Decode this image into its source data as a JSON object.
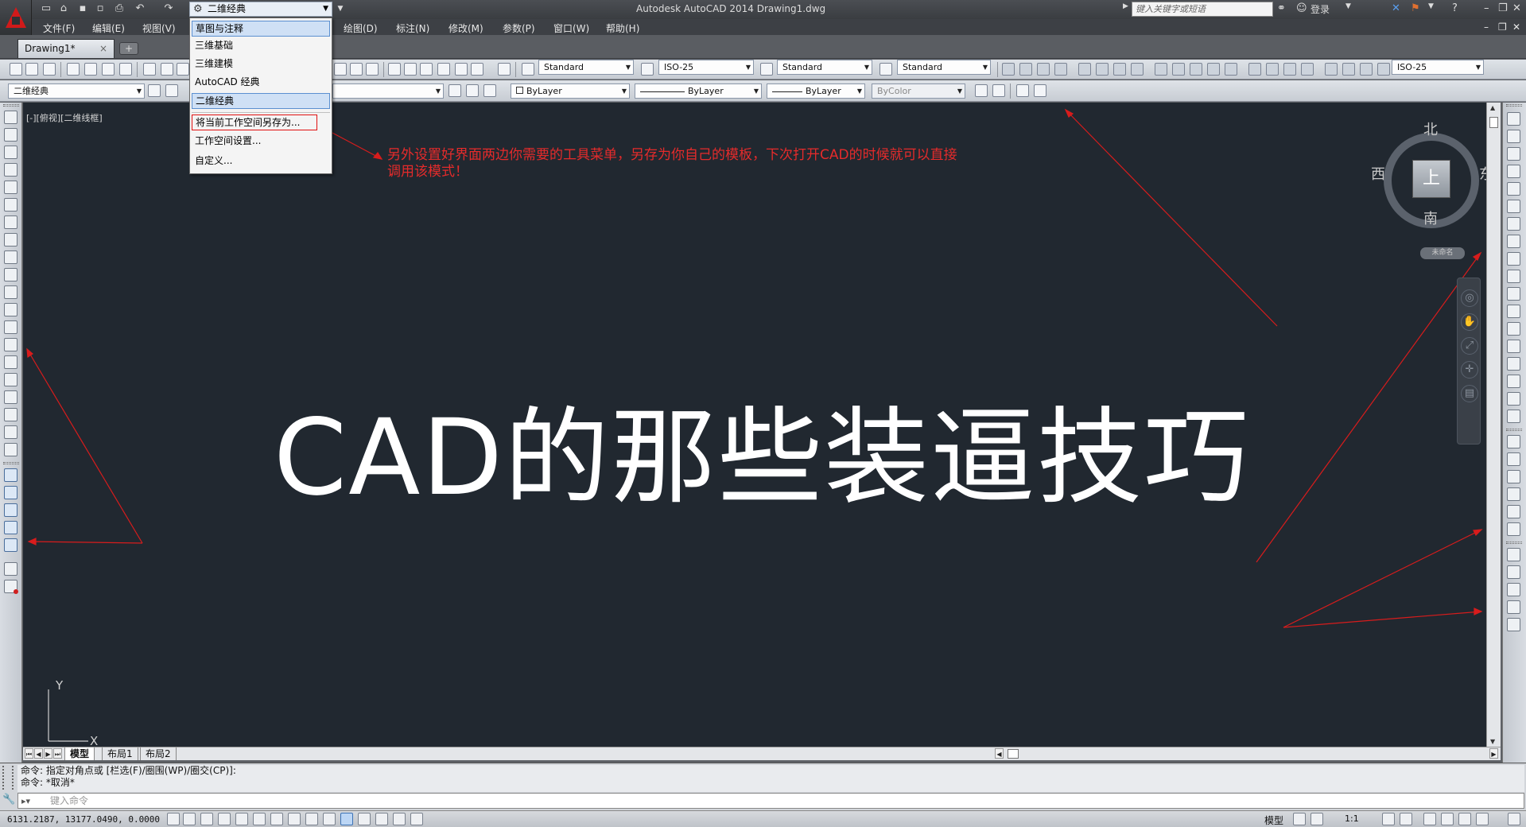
{
  "title_bar": {
    "workspace_current": "二维经典",
    "app_title": "Autodesk AutoCAD 2014    Drawing1.dwg",
    "search_placeholder": "键入关键字或短语",
    "login_label": "登录"
  },
  "menu": [
    "文件(F)",
    "编辑(E)",
    "视图(V)",
    "绘图(D)",
    "标注(N)",
    "修改(M)",
    "参数(P)",
    "窗口(W)",
    "帮助(H)"
  ],
  "file_tab": {
    "label": "Drawing1*",
    "close": "×"
  },
  "workspace_dropdown": {
    "items": [
      "草图与注释",
      "三维基础",
      "三维建模",
      "AutoCAD 经典",
      "二维经典"
    ],
    "save_as": "将当前工作空间另存为...",
    "settings": "工作空间设置...",
    "customize": "自定义..."
  },
  "toolbar1": {
    "text_style": "Standard",
    "dim_style": "ISO-25",
    "table_style": "Standard",
    "multileader_style": "Standard",
    "right_dim_style": "ISO-25"
  },
  "toolbar2": {
    "workspace": "二维经典",
    "color": "ByLayer",
    "linetype": "ByLayer",
    "lineweight": "ByLayer",
    "plotstyle": "ByColor"
  },
  "canvas": {
    "view_label": "[-][俯视][二维线框]",
    "big_text": "CAD的那些装逼技巧",
    "annotation": "另外设置好界面两边你需要的工具菜单，另存为你自己的模板，下次打开CAD的时候就可以直接调用该模式！",
    "ucs_y": "Y",
    "ucs_x": "X",
    "annotation_color": "#e52b2b"
  },
  "viewcube": {
    "north": "北",
    "south": "南",
    "west": "西",
    "east": "东",
    "face": "上",
    "wcs": "未命名"
  },
  "layout_tabs": [
    "模型",
    "布局1",
    "布局2"
  ],
  "command": {
    "line1": "命令: 指定对角点或 [栏选(F)/圈围(WP)/圈交(CP)]:",
    "line2": "命令: *取消*",
    "input_placeholder": "键入命令"
  },
  "status": {
    "coords": "6131.2187,  13177.0490,  0.0000",
    "model": "模型",
    "scale": "1:1"
  }
}
